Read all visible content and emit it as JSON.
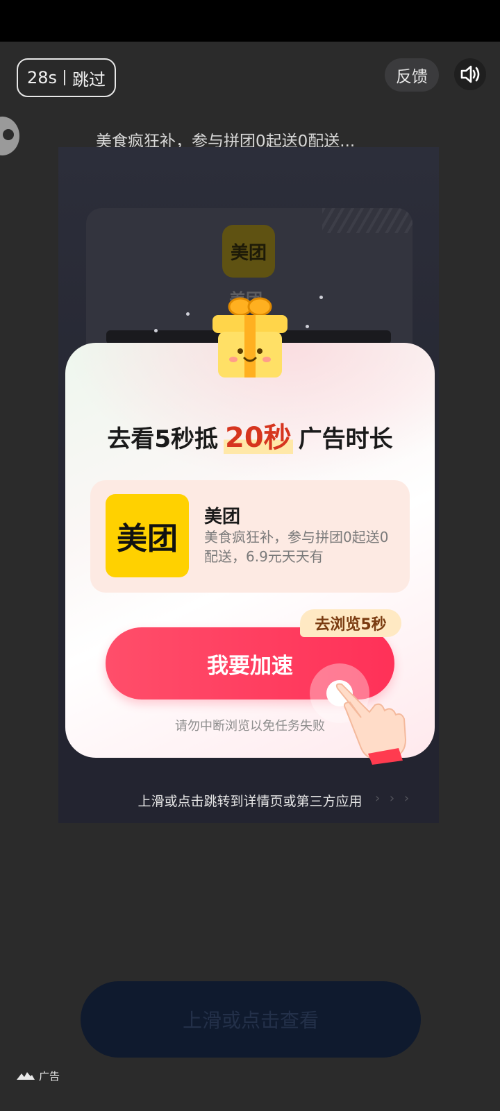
{
  "top_bar": {
    "countdown": "28s",
    "skip_label": "跳过",
    "feedback_label": "反馈"
  },
  "ad": {
    "title": "美食疯狂补，参与拼团0起送0配送...",
    "background_brand": "美团",
    "bottom_hint": "上滑或点击跳转到详情页或第三方应用",
    "bottom_hint_arrows": "› › ›"
  },
  "dialog": {
    "headline_before": "去看5秒抵",
    "headline_highlight": "20秒",
    "headline_after": "广告时长",
    "app": {
      "logo_text": "美团",
      "name": "美团",
      "description": "美食疯狂补，参与拼团0起送0配送，6.9元天天有"
    },
    "badge": "去浏览5秒",
    "cta_label": "我要加速",
    "warning": "请勿中断浏览以免任务失败"
  },
  "bottom": {
    "cta_label": "上滑或点击查看",
    "ad_tag": "广告"
  },
  "colors": {
    "accent_red": "#ff3d5e",
    "highlight_orange": "#d6351f",
    "meituan_yellow": "#ffd100"
  }
}
